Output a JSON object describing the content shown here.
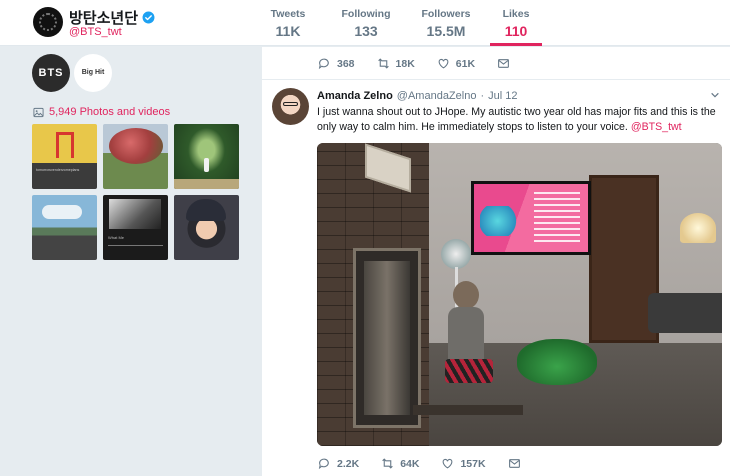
{
  "profile": {
    "name": "방탄소년단",
    "handle": "@BTS_twt"
  },
  "stats": [
    {
      "label": "Tweets",
      "value": "11K"
    },
    {
      "label": "Following",
      "value": "133"
    },
    {
      "label": "Followers",
      "value": "15.5M"
    },
    {
      "label": "Likes",
      "value": "110"
    }
  ],
  "sidebar": {
    "chips": [
      "BTS",
      "Big Hit"
    ],
    "photos_link": "5,949 Photos and videos",
    "thumb_captions": [
      "tomorrowvenderzomeplans",
      "What Me"
    ]
  },
  "prev_tweet_actions": {
    "replies": "368",
    "retweets": "18K",
    "likes": "61K"
  },
  "tweet": {
    "author_name": "Amanda Zelno",
    "author_handle": "@AmandaZelno",
    "separator": "·",
    "date": "Jul 12",
    "text": "I just wanna shout out to JHope. My autistic two year old has major fits and this is the only way to calm him. He immediately stops to listen to your voice.",
    "mention": "@BTS_twt",
    "actions": {
      "replies": "2.2K",
      "retweets": "64K",
      "likes": "157K"
    }
  },
  "colors": {
    "accent": "#e0245e",
    "muted": "#657786",
    "background": "#e6ecf0",
    "verified": "#1da1f2"
  },
  "icons": {
    "verified": "verified-badge-icon",
    "photos": "image-icon",
    "reply": "reply-icon",
    "retweet": "retweet-icon",
    "like": "heart-icon",
    "message": "envelope-icon",
    "caret": "chevron-down-icon"
  }
}
